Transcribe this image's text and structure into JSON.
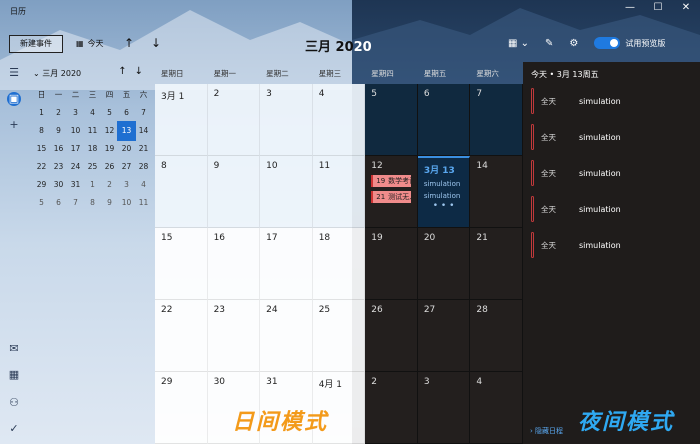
{
  "window": {
    "title": "日历",
    "controls": [
      "—",
      "☐",
      "✕"
    ]
  },
  "toolbar": {
    "new_event": "新建事件",
    "today": "今天",
    "prev": "↑",
    "next": "↓",
    "month_title_a": "三月 20",
    "month_title_b": "20",
    "view_icon": "calendar-view-icon",
    "preview_label": "试用预览版"
  },
  "mini_calendar": {
    "title": "三月 2020",
    "weekdays": [
      "日",
      "一",
      "二",
      "三",
      "四",
      "五",
      "六"
    ],
    "days": [
      [
        1,
        2,
        3,
        4,
        5,
        6,
        7
      ],
      [
        8,
        9,
        10,
        11,
        12,
        13,
        14
      ],
      [
        15,
        16,
        17,
        18,
        19,
        20,
        21
      ],
      [
        22,
        23,
        24,
        25,
        26,
        27,
        28
      ],
      [
        29,
        30,
        31,
        1,
        2,
        3,
        4
      ],
      [
        5,
        6,
        7,
        8,
        9,
        10,
        11
      ]
    ],
    "selected": 13
  },
  "grid": {
    "weekdays": [
      "星期日",
      "星期一",
      "星期二",
      "星期三",
      "星期四",
      "星期五",
      "星期六"
    ],
    "weeks": [
      [
        "3月 1",
        "2",
        "3",
        "4",
        "5",
        "6",
        "7"
      ],
      [
        "8",
        "9",
        "10",
        "11",
        "12",
        "3月 13",
        "14"
      ],
      [
        "15",
        "16",
        "17",
        "18",
        "19",
        "20",
        "21"
      ],
      [
        "22",
        "23",
        "24",
        "25",
        "26",
        "27",
        "28"
      ],
      [
        "29",
        "30",
        "31",
        "4月 1",
        "2",
        "3",
        "4"
      ]
    ],
    "events_thu12": [
      {
        "num": "19",
        "text": "数学考试"
      },
      {
        "num": "21",
        "text": "测试无人"
      }
    ],
    "events_fri13": [
      "simulation",
      "simulation"
    ],
    "more": "• • •"
  },
  "agenda": {
    "title": "今天 • 3月 13周五",
    "items": [
      {
        "time": "全天",
        "name": "simulation"
      },
      {
        "time": "全天",
        "name": "simulation"
      },
      {
        "time": "全天",
        "name": "simulation"
      },
      {
        "time": "全天",
        "name": "simulation"
      },
      {
        "time": "全天",
        "name": "simulation"
      }
    ],
    "hide": "隐藏日程"
  },
  "labels": {
    "day_mode": "日间模式",
    "night_mode": "夜间模式"
  },
  "colors": {
    "accent": "#1f6fd1",
    "event_red": "#f08b8b",
    "day_label": "#f39a1a",
    "night_label": "#2fa9f2"
  }
}
